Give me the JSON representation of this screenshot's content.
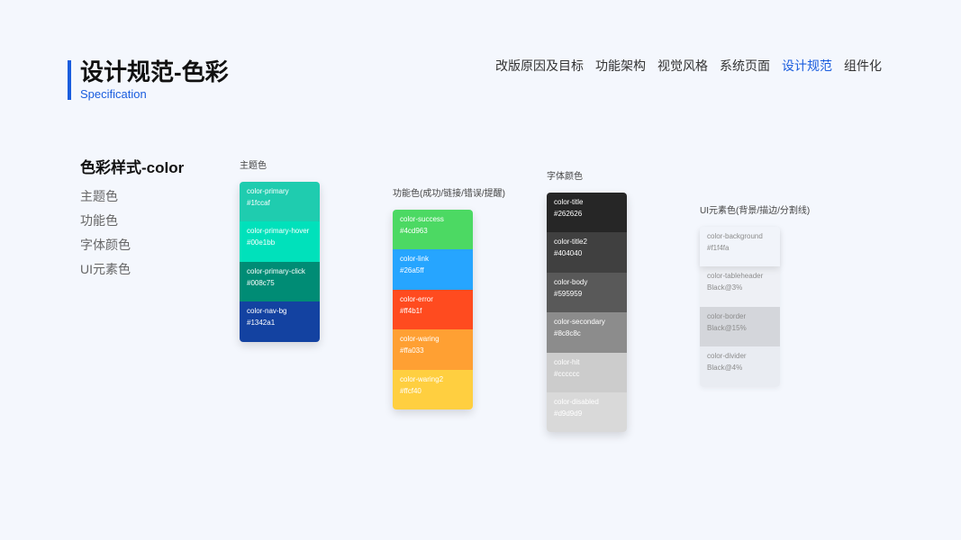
{
  "page": {
    "background": "#f4f7fd",
    "accent": "#1a5dde"
  },
  "header": {
    "title": "设计规范-色彩",
    "subtitle": "Specification"
  },
  "nav": {
    "items": [
      {
        "label": "改版原因及目标",
        "active": false
      },
      {
        "label": "功能架构",
        "active": false
      },
      {
        "label": "视觉风格",
        "active": false
      },
      {
        "label": "系统页面",
        "active": false
      },
      {
        "label": "设计规范",
        "active": true
      },
      {
        "label": "组件化",
        "active": false
      }
    ]
  },
  "sidebar": {
    "title": "色彩样式-color",
    "items": [
      "主题色",
      "功能色",
      "字体颜色",
      "UI元素色"
    ]
  },
  "palettes": [
    {
      "label": "主题色",
      "swatches": [
        {
          "name": "color-primary",
          "value": "#1fccaf",
          "fill": "#1fccaf",
          "text_color": "#ffffff"
        },
        {
          "name": "color-primary-hover",
          "value": "#00e1bb",
          "fill": "#00e1bb",
          "text_color": "#ffffff"
        },
        {
          "name": "color-primary-click",
          "value": "#008c75",
          "fill": "#008c75",
          "text_color": "#ffffff"
        },
        {
          "name": "color-nav-bg",
          "value": "#1342a1",
          "fill": "#1342a1",
          "text_color": "#ffffff"
        }
      ]
    },
    {
      "label": "功能色(成功/链接/错误/提醒)",
      "swatches": [
        {
          "name": "color-success",
          "value": "#4cd963",
          "fill": "#4cd963",
          "text_color": "#ffffff"
        },
        {
          "name": "color-link",
          "value": "#26a5ff",
          "fill": "#26a5ff",
          "text_color": "#ffffff"
        },
        {
          "name": "color-error",
          "value": "#ff4b1f",
          "fill": "#ff4b1f",
          "text_color": "#ffffff"
        },
        {
          "name": "color-waring",
          "value": "#ffa033",
          "fill": "#ffa033",
          "text_color": "#ffffff"
        },
        {
          "name": "color-waring2",
          "value": "#ffcf40",
          "fill": "#ffcf40",
          "text_color": "#ffffff"
        }
      ]
    },
    {
      "label": "字体颜色",
      "swatches": [
        {
          "name": "color-title",
          "value": "#262626",
          "fill": "#262626",
          "text_color": "#ffffff"
        },
        {
          "name": "color-title2",
          "value": "#404040",
          "fill": "#404040",
          "text_color": "#ffffff"
        },
        {
          "name": "color-body",
          "value": "#595959",
          "fill": "#595959",
          "text_color": "#ffffff"
        },
        {
          "name": "color-secondary",
          "value": "#8c8c8c",
          "fill": "#8c8c8c",
          "text_color": "#ffffff"
        },
        {
          "name": "color-hit",
          "value": "#cccccc",
          "fill": "#cccccc",
          "text_color": "#ffffff"
        },
        {
          "name": "color-disabled",
          "value": "#d9d9d9",
          "fill": "#d9d9d9",
          "text_color": "#ffffff"
        }
      ]
    },
    {
      "label": "UI元素色(背景/描边/分割线)",
      "swatches": [
        {
          "name": "color-background",
          "value": "#f1f4fa",
          "fill": "#f1f4fa",
          "text_color": "#8c8c8c"
        },
        {
          "name": "color-tableheader",
          "value": "Black@3%",
          "fill": "#eef0f5",
          "text_color": "#8c8c8c"
        },
        {
          "name": "color-border",
          "value": "Black@15%",
          "fill": "#d4d6db",
          "text_color": "#8c8c8c"
        },
        {
          "name": "color-divider",
          "value": "Black@4%",
          "fill": "#e9ecf2",
          "text_color": "#8c8c8c"
        }
      ]
    }
  ]
}
